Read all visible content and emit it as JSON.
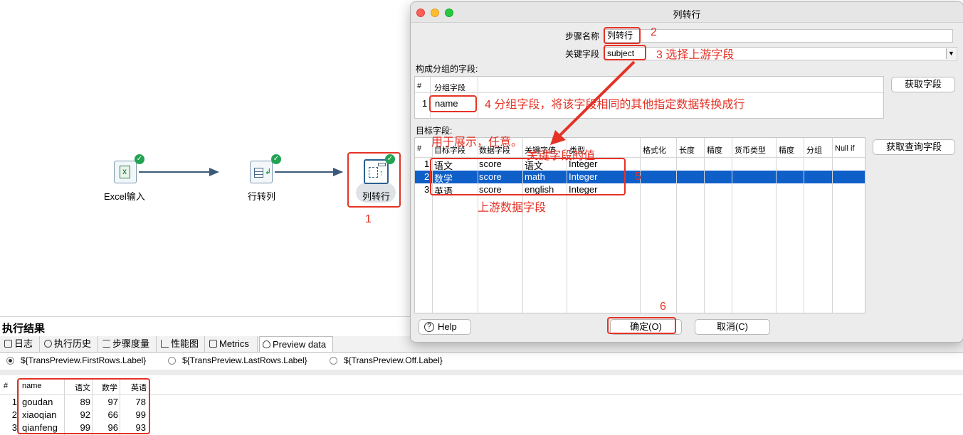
{
  "canvas": {
    "steps": [
      {
        "label": "Excel输入",
        "icon": "excel-icon"
      },
      {
        "label": "行转列",
        "icon": "row-to-column-icon"
      },
      {
        "label": "列转行",
        "icon": "column-to-row-icon"
      }
    ],
    "annotation_1": "1"
  },
  "dialog": {
    "title": "列转行",
    "step_name_label": "步骤名称",
    "step_name_value": "列转行",
    "key_field_label": "关键字段",
    "key_field_value": "subject",
    "group_section_label": "构成分组的字段:",
    "group_grid": {
      "headers": [
        "#",
        "分组字段"
      ],
      "rows": [
        {
          "no": "1",
          "field": "name"
        }
      ]
    },
    "get_fields_button": "获取字段",
    "target_section_label": "目标字段:",
    "get_lookup_fields_button": "获取查询字段",
    "target_grid": {
      "headers": [
        "#",
        "目标字段",
        "数据字段",
        "关键字值",
        "类型",
        "格式化",
        "长度",
        "精度",
        "货币类型",
        "精度",
        "分组",
        "Null if"
      ],
      "rows": [
        {
          "no": "1",
          "target": "语文",
          "data": "score",
          "key": "语文",
          "type": "Integer"
        },
        {
          "no": "2",
          "target": "数学",
          "data": "score",
          "key": "math",
          "type": "Integer"
        },
        {
          "no": "3",
          "target": "英语",
          "data": "score",
          "key": "english",
          "type": "Integer"
        }
      ]
    },
    "help_button": "Help",
    "ok_button": "确定(O)",
    "cancel_button": "取消(C)",
    "annotations": {
      "a2": "2",
      "a3": "3  选择上游字段",
      "a4": "4 分组字段，将该字段相同的其他指定数据转换成行",
      "show_any": "用于展示，任意。",
      "key_value": "关键字段的值",
      "a5": "5",
      "upstream": "上游数据字段",
      "a6": "6"
    }
  },
  "results": {
    "title": "执行结果",
    "tabs": [
      {
        "label": "日志",
        "icon": "log-icon"
      },
      {
        "label": "执行历史",
        "icon": "history-icon"
      },
      {
        "label": "步骤度量",
        "icon": "step-metrics-icon"
      },
      {
        "label": "性能图",
        "icon": "perf-chart-icon"
      },
      {
        "label": "Metrics",
        "icon": "metrics-icon"
      },
      {
        "label": "Preview data",
        "icon": "eye-icon"
      }
    ],
    "radios": [
      {
        "label": "${TransPreview.FirstRows.Label}",
        "selected": true
      },
      {
        "label": "${TransPreview.LastRows.Label}",
        "selected": false
      },
      {
        "label": "${TransPreview.Off.Label}",
        "selected": false
      }
    ],
    "preview": {
      "headers": [
        "#",
        "name",
        "语文",
        "数学",
        "英语"
      ],
      "rows": [
        {
          "no": "1",
          "name": "goudan",
          "c1": "89",
          "c2": "97",
          "c3": "78"
        },
        {
          "no": "2",
          "name": "xiaoqian",
          "c1": "92",
          "c2": "66",
          "c3": "99"
        },
        {
          "no": "3",
          "name": "qianfeng",
          "c1": "99",
          "c2": "96",
          "c3": "93"
        }
      ]
    }
  },
  "colors": {
    "annotation_red": "#e53226",
    "selection_blue": "#0f5fc9",
    "check_green": "#21a352"
  }
}
